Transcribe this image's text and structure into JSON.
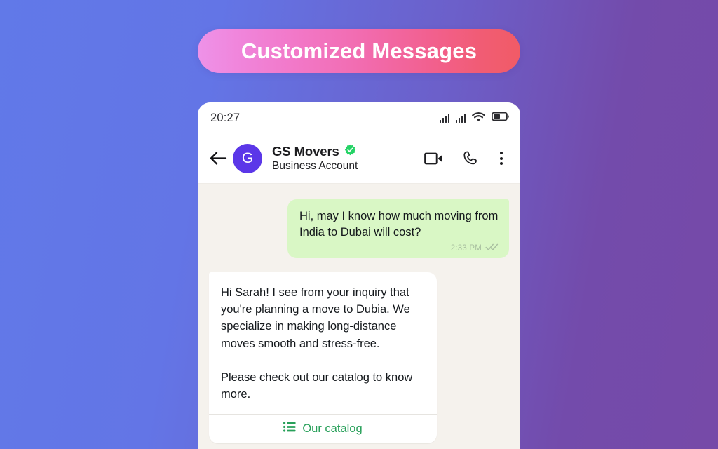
{
  "banner": {
    "title": "Customized Messages",
    "gradient_from": "#EE92E8",
    "gradient_to": "#F15B66"
  },
  "background": {
    "gradient_from": "#6179E8",
    "gradient_to": "#764AA8"
  },
  "phone": {
    "status_bar": {
      "time": "20:27",
      "icons": [
        "signal-bars-icon",
        "signal-bars-icon",
        "wifi-icon",
        "battery-icon"
      ]
    },
    "chat_header": {
      "back_icon": "back-arrow-icon",
      "avatar_initial": "G",
      "avatar_color": "#5B37E8",
      "contact_name": "GS Movers",
      "verified_badge": "verified-badge-icon",
      "verified_color": "#25D366",
      "subtitle": "Business Account",
      "actions": [
        "video-call-icon",
        "voice-call-icon",
        "overflow-menu-icon"
      ]
    },
    "conversation": {
      "background_color": "#F5F2ED",
      "messages": [
        {
          "direction": "outgoing",
          "text": "Hi, may I know how much moving from India to Dubai will cost?",
          "time": "2:33 PM",
          "status_icon": "double-check-icon",
          "bubble_color": "#D9F7C5"
        },
        {
          "direction": "incoming",
          "text": "Hi Sarah! I see from your inquiry that you're planning a move to Dubia. We specialize in making long-distance moves smooth and stress-free.\n\nPlease check out our catalog to know more.",
          "bubble_color": "#FFFFFF",
          "action": {
            "icon": "list-icon",
            "label": "Our catalog",
            "color": "#28A05A"
          }
        }
      ]
    }
  }
}
